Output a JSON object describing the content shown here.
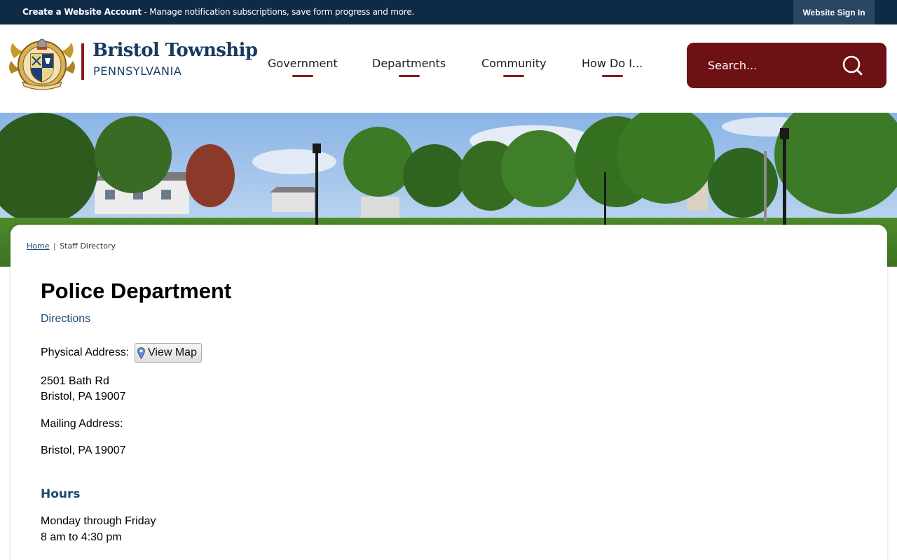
{
  "topbar": {
    "create_account": "Create a Website Account",
    "message": " - Manage notification subscriptions, save form progress and more.",
    "sign_in": "Website Sign In"
  },
  "header": {
    "title": "Bristol Township",
    "subtitle": "PENNSYLVANIA",
    "nav": [
      {
        "label": "Government"
      },
      {
        "label": "Departments"
      },
      {
        "label": "Community"
      },
      {
        "label": "How Do I..."
      }
    ],
    "search_placeholder": "Search...",
    "accent_color": "#6e1114",
    "brand_color": "#173b60"
  },
  "breadcrumb": {
    "home": "Home",
    "separator": "|",
    "current": "Staff Directory"
  },
  "department": {
    "title": "Police Department",
    "directions": "Directions",
    "physical_label": "Physical Address:",
    "view_map": "View Map",
    "address_line1": "2501 Bath Rd",
    "address_line2": "Bristol, PA 19007",
    "mailing_label": "Mailing Address:",
    "mailing_city": "Bristol, PA 19007",
    "hours_title": "Hours",
    "hours_line1": "Monday through Friday",
    "hours_line2": "8 am to 4:30 pm"
  }
}
